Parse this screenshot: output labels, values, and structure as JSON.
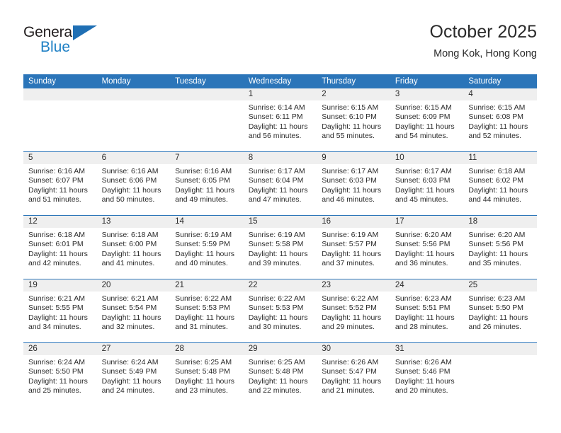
{
  "logo": {
    "word_top": "General",
    "word_bottom": "Blue",
    "triangle_color": "#1f6fb4",
    "blue_color": "#1d7fc4"
  },
  "header": {
    "title": "October 2025",
    "subtitle": "Mong Kok, Hong Kong"
  },
  "theme": {
    "header_blue": "#2b75b9",
    "daynum_band": "#efefef",
    "text": "#2b2b2b"
  },
  "calendar": {
    "weekday_headers": [
      "Sunday",
      "Monday",
      "Tuesday",
      "Wednesday",
      "Thursday",
      "Friday",
      "Saturday"
    ],
    "weeks": [
      [
        {
          "day": "",
          "sunrise": "",
          "sunset": "",
          "daylight": "",
          "daylight2": ""
        },
        {
          "day": "",
          "sunrise": "",
          "sunset": "",
          "daylight": "",
          "daylight2": ""
        },
        {
          "day": "",
          "sunrise": "",
          "sunset": "",
          "daylight": "",
          "daylight2": ""
        },
        {
          "day": "1",
          "sunrise": "Sunrise: 6:14 AM",
          "sunset": "Sunset: 6:11 PM",
          "daylight": "Daylight: 11 hours",
          "daylight2": "and 56 minutes."
        },
        {
          "day": "2",
          "sunrise": "Sunrise: 6:15 AM",
          "sunset": "Sunset: 6:10 PM",
          "daylight": "Daylight: 11 hours",
          "daylight2": "and 55 minutes."
        },
        {
          "day": "3",
          "sunrise": "Sunrise: 6:15 AM",
          "sunset": "Sunset: 6:09 PM",
          "daylight": "Daylight: 11 hours",
          "daylight2": "and 54 minutes."
        },
        {
          "day": "4",
          "sunrise": "Sunrise: 6:15 AM",
          "sunset": "Sunset: 6:08 PM",
          "daylight": "Daylight: 11 hours",
          "daylight2": "and 52 minutes."
        }
      ],
      [
        {
          "day": "5",
          "sunrise": "Sunrise: 6:16 AM",
          "sunset": "Sunset: 6:07 PM",
          "daylight": "Daylight: 11 hours",
          "daylight2": "and 51 minutes."
        },
        {
          "day": "6",
          "sunrise": "Sunrise: 6:16 AM",
          "sunset": "Sunset: 6:06 PM",
          "daylight": "Daylight: 11 hours",
          "daylight2": "and 50 minutes."
        },
        {
          "day": "7",
          "sunrise": "Sunrise: 6:16 AM",
          "sunset": "Sunset: 6:05 PM",
          "daylight": "Daylight: 11 hours",
          "daylight2": "and 49 minutes."
        },
        {
          "day": "8",
          "sunrise": "Sunrise: 6:17 AM",
          "sunset": "Sunset: 6:04 PM",
          "daylight": "Daylight: 11 hours",
          "daylight2": "and 47 minutes."
        },
        {
          "day": "9",
          "sunrise": "Sunrise: 6:17 AM",
          "sunset": "Sunset: 6:03 PM",
          "daylight": "Daylight: 11 hours",
          "daylight2": "and 46 minutes."
        },
        {
          "day": "10",
          "sunrise": "Sunrise: 6:17 AM",
          "sunset": "Sunset: 6:03 PM",
          "daylight": "Daylight: 11 hours",
          "daylight2": "and 45 minutes."
        },
        {
          "day": "11",
          "sunrise": "Sunrise: 6:18 AM",
          "sunset": "Sunset: 6:02 PM",
          "daylight": "Daylight: 11 hours",
          "daylight2": "and 44 minutes."
        }
      ],
      [
        {
          "day": "12",
          "sunrise": "Sunrise: 6:18 AM",
          "sunset": "Sunset: 6:01 PM",
          "daylight": "Daylight: 11 hours",
          "daylight2": "and 42 minutes."
        },
        {
          "day": "13",
          "sunrise": "Sunrise: 6:18 AM",
          "sunset": "Sunset: 6:00 PM",
          "daylight": "Daylight: 11 hours",
          "daylight2": "and 41 minutes."
        },
        {
          "day": "14",
          "sunrise": "Sunrise: 6:19 AM",
          "sunset": "Sunset: 5:59 PM",
          "daylight": "Daylight: 11 hours",
          "daylight2": "and 40 minutes."
        },
        {
          "day": "15",
          "sunrise": "Sunrise: 6:19 AM",
          "sunset": "Sunset: 5:58 PM",
          "daylight": "Daylight: 11 hours",
          "daylight2": "and 39 minutes."
        },
        {
          "day": "16",
          "sunrise": "Sunrise: 6:19 AM",
          "sunset": "Sunset: 5:57 PM",
          "daylight": "Daylight: 11 hours",
          "daylight2": "and 37 minutes."
        },
        {
          "day": "17",
          "sunrise": "Sunrise: 6:20 AM",
          "sunset": "Sunset: 5:56 PM",
          "daylight": "Daylight: 11 hours",
          "daylight2": "and 36 minutes."
        },
        {
          "day": "18",
          "sunrise": "Sunrise: 6:20 AM",
          "sunset": "Sunset: 5:56 PM",
          "daylight": "Daylight: 11 hours",
          "daylight2": "and 35 minutes."
        }
      ],
      [
        {
          "day": "19",
          "sunrise": "Sunrise: 6:21 AM",
          "sunset": "Sunset: 5:55 PM",
          "daylight": "Daylight: 11 hours",
          "daylight2": "and 34 minutes."
        },
        {
          "day": "20",
          "sunrise": "Sunrise: 6:21 AM",
          "sunset": "Sunset: 5:54 PM",
          "daylight": "Daylight: 11 hours",
          "daylight2": "and 32 minutes."
        },
        {
          "day": "21",
          "sunrise": "Sunrise: 6:22 AM",
          "sunset": "Sunset: 5:53 PM",
          "daylight": "Daylight: 11 hours",
          "daylight2": "and 31 minutes."
        },
        {
          "day": "22",
          "sunrise": "Sunrise: 6:22 AM",
          "sunset": "Sunset: 5:53 PM",
          "daylight": "Daylight: 11 hours",
          "daylight2": "and 30 minutes."
        },
        {
          "day": "23",
          "sunrise": "Sunrise: 6:22 AM",
          "sunset": "Sunset: 5:52 PM",
          "daylight": "Daylight: 11 hours",
          "daylight2": "and 29 minutes."
        },
        {
          "day": "24",
          "sunrise": "Sunrise: 6:23 AM",
          "sunset": "Sunset: 5:51 PM",
          "daylight": "Daylight: 11 hours",
          "daylight2": "and 28 minutes."
        },
        {
          "day": "25",
          "sunrise": "Sunrise: 6:23 AM",
          "sunset": "Sunset: 5:50 PM",
          "daylight": "Daylight: 11 hours",
          "daylight2": "and 26 minutes."
        }
      ],
      [
        {
          "day": "26",
          "sunrise": "Sunrise: 6:24 AM",
          "sunset": "Sunset: 5:50 PM",
          "daylight": "Daylight: 11 hours",
          "daylight2": "and 25 minutes."
        },
        {
          "day": "27",
          "sunrise": "Sunrise: 6:24 AM",
          "sunset": "Sunset: 5:49 PM",
          "daylight": "Daylight: 11 hours",
          "daylight2": "and 24 minutes."
        },
        {
          "day": "28",
          "sunrise": "Sunrise: 6:25 AM",
          "sunset": "Sunset: 5:48 PM",
          "daylight": "Daylight: 11 hours",
          "daylight2": "and 23 minutes."
        },
        {
          "day": "29",
          "sunrise": "Sunrise: 6:25 AM",
          "sunset": "Sunset: 5:48 PM",
          "daylight": "Daylight: 11 hours",
          "daylight2": "and 22 minutes."
        },
        {
          "day": "30",
          "sunrise": "Sunrise: 6:26 AM",
          "sunset": "Sunset: 5:47 PM",
          "daylight": "Daylight: 11 hours",
          "daylight2": "and 21 minutes."
        },
        {
          "day": "31",
          "sunrise": "Sunrise: 6:26 AM",
          "sunset": "Sunset: 5:46 PM",
          "daylight": "Daylight: 11 hours",
          "daylight2": "and 20 minutes."
        },
        {
          "day": "",
          "sunrise": "",
          "sunset": "",
          "daylight": "",
          "daylight2": ""
        }
      ]
    ]
  }
}
